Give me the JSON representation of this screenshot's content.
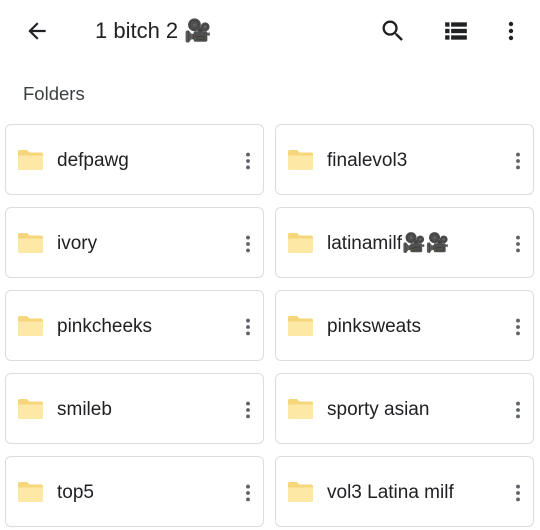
{
  "appbar": {
    "title": "1 bitch 2 🎥",
    "back_icon": "arrow-back-icon",
    "search_icon": "search-icon",
    "view_icon": "list-view-icon",
    "more_icon": "more-vert-icon"
  },
  "section": {
    "label": "Folders"
  },
  "colors": {
    "folder": "#fde8a6",
    "folder_dark": "#f6d67a",
    "border": "#dadce0",
    "icon": "#202124"
  },
  "folders": [
    {
      "name": "defpawg"
    },
    {
      "name": "finalevol3"
    },
    {
      "name": "ivory"
    },
    {
      "name": "latinamilf🎥🎥"
    },
    {
      "name": "pinkcheeks"
    },
    {
      "name": "pinksweats"
    },
    {
      "name": "smileb"
    },
    {
      "name": "sporty asian"
    },
    {
      "name": "top5"
    },
    {
      "name": "vol3 Latina milf"
    }
  ]
}
